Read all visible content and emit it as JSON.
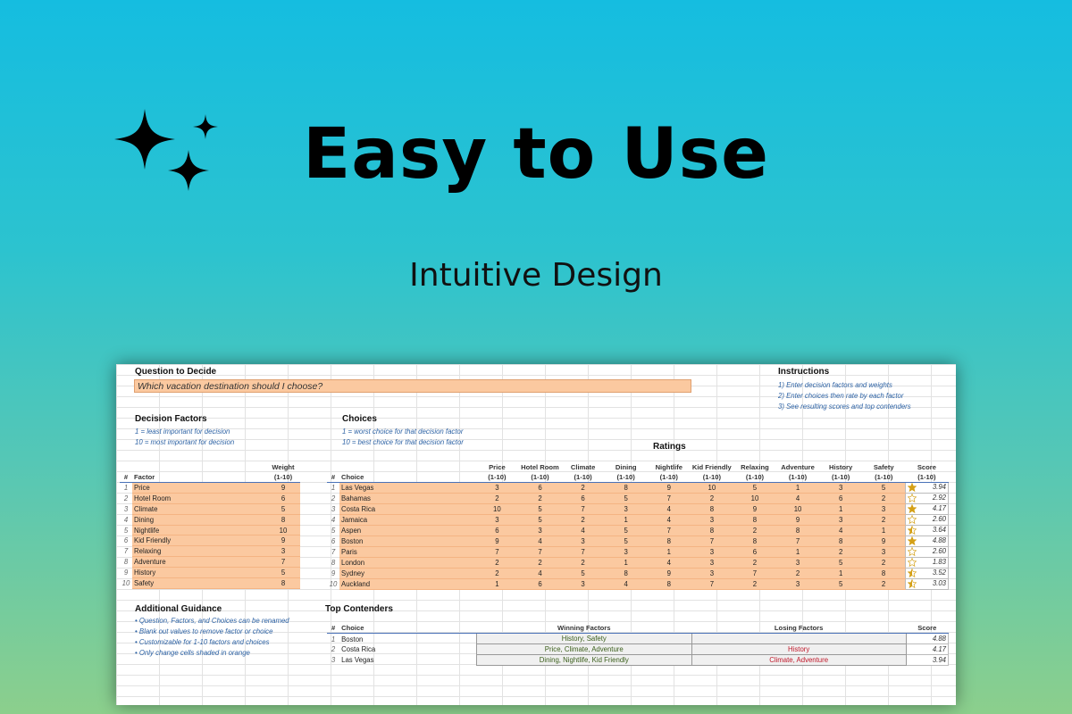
{
  "hero": {
    "title": "Easy to Use",
    "subtitle": "Intuitive Design",
    "icon": "sparkles-icon"
  },
  "sheet": {
    "question_header": "Question to Decide",
    "question_value": "Which vacation destination should I choose?",
    "instructions_header": "Instructions",
    "instructions": [
      "1) Enter decision factors and weights",
      "2) Enter choices then rate by each factor",
      "3) See resulting scores and top contenders"
    ],
    "factors_header": "Decision Factors",
    "factors_notes": [
      "1 = least important for decision",
      "10 = most important for decision"
    ],
    "choices_header": "Choices",
    "choices_notes": [
      "1 = worst choice for that decision factor",
      "10 = best choice for that decision factor"
    ],
    "ratings_header": "Ratings",
    "factor_cols": {
      "idx": "#",
      "factor": "Factor",
      "weight_l1": "Weight",
      "weight_l2": "(1-10)"
    },
    "factors": [
      {
        "idx": "1",
        "name": "Price",
        "weight": "9"
      },
      {
        "idx": "2",
        "name": "Hotel Room",
        "weight": "6"
      },
      {
        "idx": "3",
        "name": "Climate",
        "weight": "5"
      },
      {
        "idx": "4",
        "name": "Dining",
        "weight": "8"
      },
      {
        "idx": "5",
        "name": "Nightlife",
        "weight": "10"
      },
      {
        "idx": "6",
        "name": "Kid Friendly",
        "weight": "9"
      },
      {
        "idx": "7",
        "name": "Relaxing",
        "weight": "3"
      },
      {
        "idx": "8",
        "name": "Adventure",
        "weight": "7"
      },
      {
        "idx": "9",
        "name": "History",
        "weight": "5"
      },
      {
        "idx": "10",
        "name": "Safety",
        "weight": "8"
      }
    ],
    "choice_cols": {
      "idx": "#",
      "choice": "Choice",
      "range": "(1-10)",
      "score_l1": "Score",
      "score_l2": "(1-10)",
      "ratings": [
        "Price",
        "Hotel Room",
        "Climate",
        "Dining",
        "Nightlife",
        "Kid Friendly",
        "Relaxing",
        "Adventure",
        "History",
        "Safety"
      ]
    },
    "choices": [
      {
        "idx": "1",
        "name": "Las Vegas",
        "r": [
          "3",
          "6",
          "2",
          "8",
          "9",
          "10",
          "5",
          "1",
          "3",
          "5"
        ],
        "score": "3.94",
        "star": "full"
      },
      {
        "idx": "2",
        "name": "Bahamas",
        "r": [
          "2",
          "2",
          "6",
          "5",
          "7",
          "2",
          "10",
          "4",
          "6",
          "2"
        ],
        "score": "2.92",
        "star": "empty"
      },
      {
        "idx": "3",
        "name": "Costa Rica",
        "r": [
          "10",
          "5",
          "7",
          "3",
          "4",
          "8",
          "9",
          "10",
          "1",
          "3"
        ],
        "score": "4.17",
        "star": "full"
      },
      {
        "idx": "4",
        "name": "Jamaica",
        "r": [
          "3",
          "5",
          "2",
          "1",
          "4",
          "3",
          "8",
          "9",
          "3",
          "2"
        ],
        "score": "2.60",
        "star": "empty"
      },
      {
        "idx": "5",
        "name": "Aspen",
        "r": [
          "6",
          "3",
          "4",
          "5",
          "7",
          "8",
          "2",
          "8",
          "4",
          "1"
        ],
        "score": "3.64",
        "star": "half"
      },
      {
        "idx": "6",
        "name": "Boston",
        "r": [
          "9",
          "4",
          "3",
          "5",
          "8",
          "7",
          "8",
          "7",
          "8",
          "9"
        ],
        "score": "4.88",
        "star": "full"
      },
      {
        "idx": "7",
        "name": "Paris",
        "r": [
          "7",
          "7",
          "7",
          "3",
          "1",
          "3",
          "6",
          "1",
          "2",
          "3"
        ],
        "score": "2.60",
        "star": "empty"
      },
      {
        "idx": "8",
        "name": "London",
        "r": [
          "2",
          "2",
          "2",
          "1",
          "4",
          "3",
          "2",
          "3",
          "5",
          "2"
        ],
        "score": "1.83",
        "star": "empty"
      },
      {
        "idx": "9",
        "name": "Sydney",
        "r": [
          "2",
          "4",
          "5",
          "8",
          "9",
          "3",
          "7",
          "2",
          "1",
          "8"
        ],
        "score": "3.52",
        "star": "half"
      },
      {
        "idx": "10",
        "name": "Auckland",
        "r": [
          "1",
          "6",
          "3",
          "4",
          "8",
          "7",
          "2",
          "3",
          "5",
          "2"
        ],
        "score": "3.03",
        "star": "half"
      }
    ],
    "guidance_header": "Additional Guidance",
    "guidance": [
      "• Question, Factors, and Choices can be renamed",
      "• Blank out values to remove factor or choice",
      "• Customizable for 1-10 factors and choices",
      "• Only change cells shaded in orange"
    ],
    "top_header": "Top Contenders",
    "top_cols": {
      "idx": "#",
      "choice": "Choice",
      "winning": "Winning Factors",
      "losing": "Losing Factors",
      "score": "Score"
    },
    "top": [
      {
        "idx": "1",
        "name": "Boston",
        "winning": "History, Safety",
        "losing": "",
        "score": "4.88"
      },
      {
        "idx": "2",
        "name": "Costa Rica",
        "winning": "Price, Climate, Adventure",
        "losing": "History",
        "score": "4.17"
      },
      {
        "idx": "3",
        "name": "Las Vegas",
        "winning": "Dining, Nightlife, Kid Friendly",
        "losing": "Climate, Adventure",
        "score": "3.94"
      }
    ],
    "colors": {
      "orange_cell": "#fbc9a0",
      "star": "#d4a017",
      "winning": "#3a5e1a",
      "losing": "#c0182a",
      "header_line": "#4a72b8"
    }
  }
}
